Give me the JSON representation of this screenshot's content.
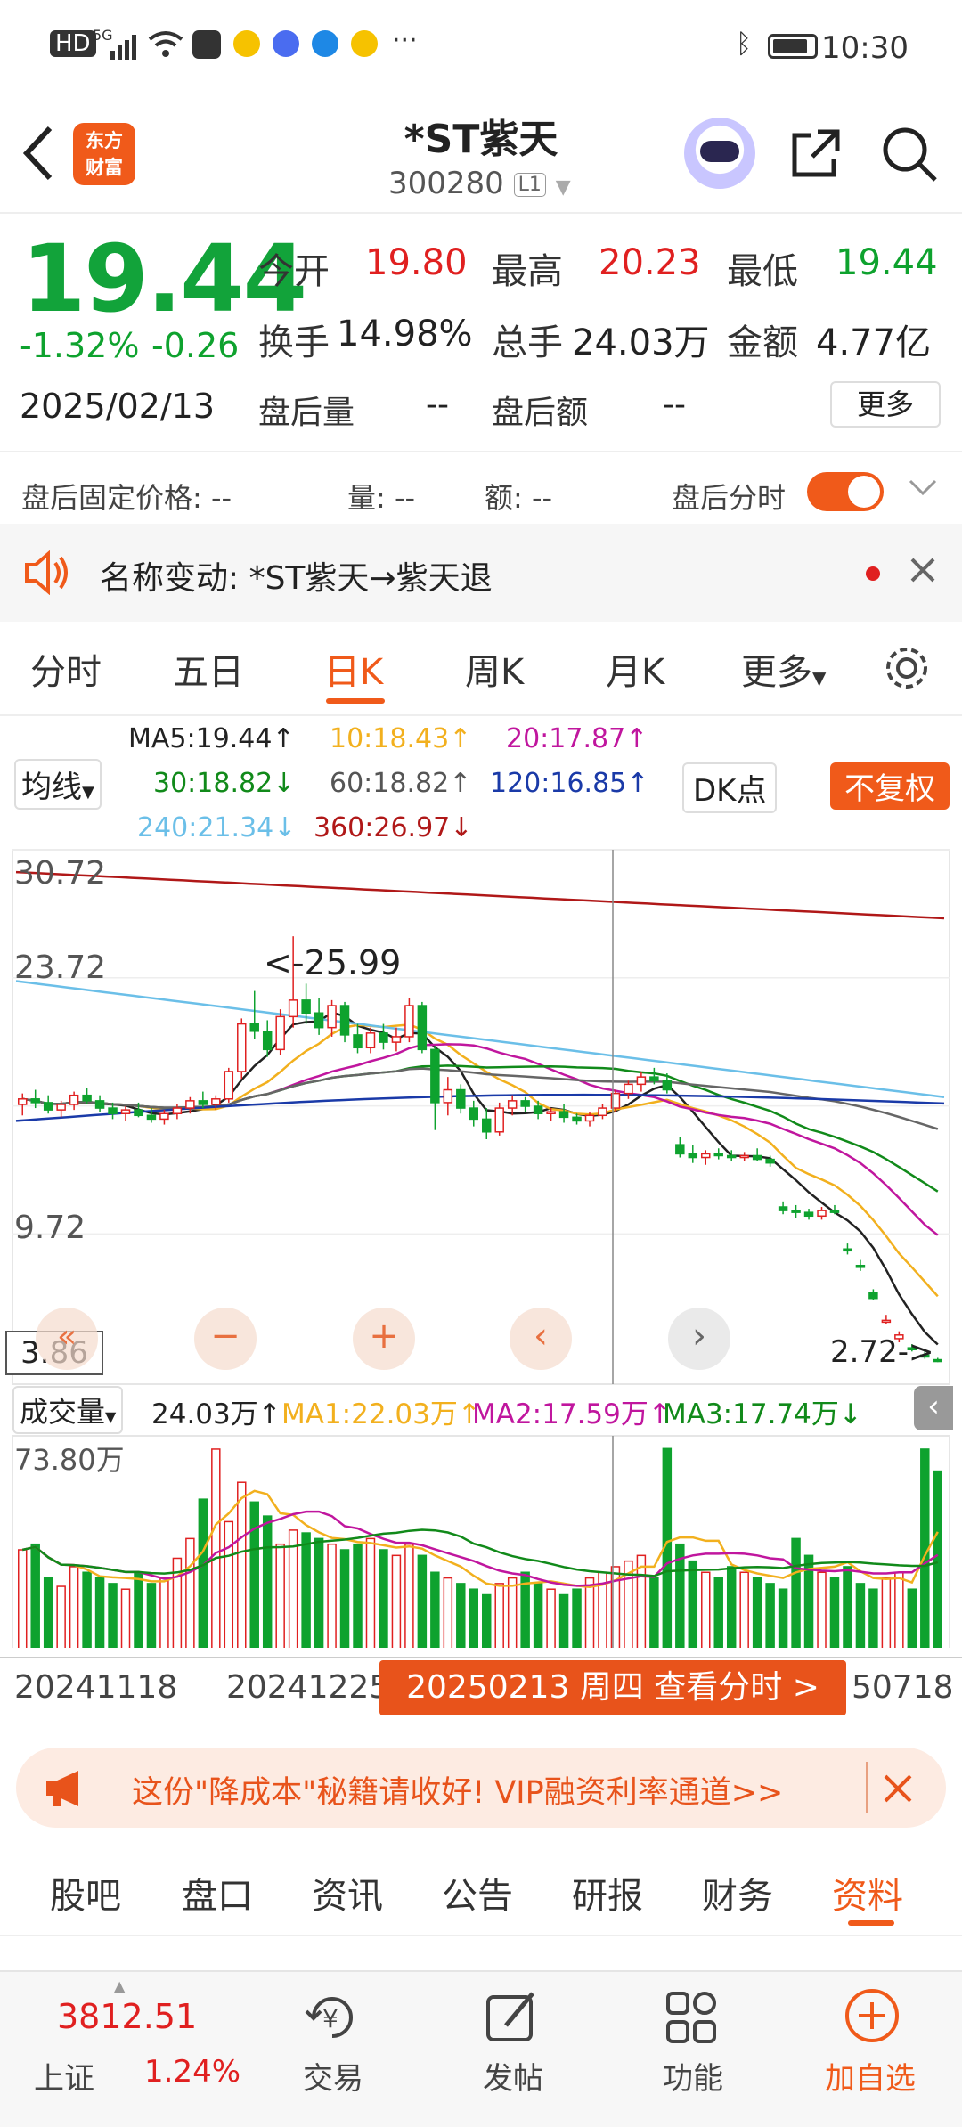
{
  "status_bar": {
    "time": "10:30",
    "network": "5G"
  },
  "header": {
    "title": "*ST紫天",
    "code": "300280",
    "level": "L1",
    "logo_line1": "东方",
    "logo_line2": "财富"
  },
  "quote": {
    "price": "19.44",
    "change_pct": "-1.32%",
    "change": "-0.26",
    "date": "2025/02/13",
    "open_label": "今开",
    "open": "19.80",
    "high_label": "最高",
    "high": "20.23",
    "low_label": "最低",
    "low": "19.44",
    "turnover_label": "换手",
    "turnover": "14.98%",
    "volume_label": "总手",
    "volume": "24.03万",
    "amount_label": "金额",
    "amount": "4.77亿",
    "after_vol_label": "盘后量",
    "after_vol": "--",
    "after_amt_label": "盘后额",
    "after_amt": "--",
    "more": "更多"
  },
  "after_hours": {
    "price_label": "盘后固定价格: --",
    "vol_label": "量: --",
    "amt_label": "额: --",
    "toggle_label": "盘后分时"
  },
  "notice": {
    "text": "名称变动: *ST紫天→紫天退"
  },
  "tabs": [
    "分时",
    "五日",
    "日K",
    "周K",
    "月K",
    "更多"
  ],
  "ma_legend": {
    "selector": "均线",
    "ma5": "MA5:19.44↑",
    "ma10": "10:18.43↑",
    "ma20": "20:17.87↑",
    "ma30": "30:18.82↓",
    "ma60": "60:18.82↑",
    "ma120": "120:16.85↑",
    "ma240": "240:21.34↓",
    "ma360": "360:26.97↓",
    "dk": "DK点",
    "adjust": "不复权"
  },
  "chart_data": {
    "type": "candlestick",
    "y_ticks": [
      "30.72",
      "23.72",
      "9.72",
      "3.86"
    ],
    "annotation_high": "<-25.99",
    "annotation_low": "2.72->",
    "x_labels": [
      "20241118",
      "20241225",
      "50718"
    ],
    "crosshair_label": "20250213 周四 查看分时 >",
    "volume": {
      "selector": "成交量",
      "current": "24.03万↑",
      "ma1": "MA1:22.03万↑",
      "ma2": "MA2:17.59万↑",
      "ma3": "MA3:17.74万↓",
      "y_tick": "73.80万"
    },
    "candles": [
      [
        16.8,
        17.4,
        16.2,
        17.1
      ],
      [
        17.1,
        17.6,
        16.6,
        16.9
      ],
      [
        16.9,
        17.3,
        16.3,
        16.5
      ],
      [
        16.5,
        17.0,
        16.1,
        16.8
      ],
      [
        16.8,
        17.5,
        16.5,
        17.3
      ],
      [
        17.3,
        17.7,
        16.8,
        17.0
      ],
      [
        17.0,
        17.3,
        16.4,
        16.6
      ],
      [
        16.6,
        16.9,
        16.0,
        16.3
      ],
      [
        16.3,
        16.7,
        15.9,
        16.5
      ],
      [
        16.5,
        16.9,
        16.1,
        16.2
      ],
      [
        16.2,
        16.6,
        15.8,
        16.0
      ],
      [
        16.0,
        16.5,
        15.7,
        16.3
      ],
      [
        16.3,
        16.8,
        16.0,
        16.6
      ],
      [
        16.6,
        17.2,
        16.3,
        17.0
      ],
      [
        17.0,
        17.5,
        16.6,
        16.8
      ],
      [
        16.8,
        17.3,
        16.5,
        17.1
      ],
      [
        17.1,
        18.8,
        16.9,
        18.6
      ],
      [
        18.6,
        21.5,
        18.2,
        21.2
      ],
      [
        21.2,
        23.0,
        20.4,
        20.8
      ],
      [
        20.8,
        21.4,
        19.4,
        19.8
      ],
      [
        19.8,
        22.0,
        19.5,
        21.6
      ],
      [
        21.6,
        25.99,
        21.0,
        22.5
      ],
      [
        22.5,
        23.4,
        21.2,
        21.8
      ],
      [
        21.8,
        22.6,
        20.6,
        21.0
      ],
      [
        21.0,
        22.5,
        20.5,
        22.2
      ],
      [
        22.2,
        22.4,
        20.2,
        20.6
      ],
      [
        20.6,
        21.2,
        19.6,
        19.9
      ],
      [
        19.9,
        21.0,
        19.6,
        20.7
      ],
      [
        20.7,
        21.2,
        19.8,
        20.2
      ],
      [
        20.2,
        21.0,
        19.7,
        20.5
      ],
      [
        20.5,
        22.6,
        20.2,
        22.2
      ],
      [
        22.2,
        22.4,
        19.6,
        19.8
      ],
      [
        19.8,
        20.0,
        15.4,
        16.9
      ],
      [
        16.9,
        18.3,
        16.2,
        17.6
      ],
      [
        17.6,
        17.9,
        16.3,
        16.6
      ],
      [
        16.6,
        17.0,
        15.6,
        16.0
      ],
      [
        16.0,
        16.6,
        14.9,
        15.3
      ],
      [
        15.3,
        16.9,
        15.1,
        16.6
      ],
      [
        16.6,
        17.3,
        16.2,
        17.0
      ],
      [
        17.0,
        17.2,
        16.4,
        16.7
      ],
      [
        16.7,
        17.0,
        16.0,
        16.3
      ],
      [
        16.3,
        16.6,
        15.9,
        16.4
      ],
      [
        16.4,
        16.8,
        15.8,
        16.1
      ],
      [
        16.1,
        16.3,
        15.7,
        15.9
      ],
      [
        15.9,
        16.4,
        15.6,
        16.2
      ],
      [
        16.2,
        16.8,
        16.0,
        16.6
      ],
      [
        16.6,
        17.6,
        16.4,
        17.4
      ],
      [
        17.4,
        18.1,
        17.1,
        17.9
      ],
      [
        17.9,
        18.6,
        17.5,
        18.3
      ],
      [
        18.3,
        18.8,
        17.9,
        18.1
      ],
      [
        18.1,
        18.5,
        17.4,
        17.6
      ],
      [
        14.6,
        15.0,
        13.9,
        14.1
      ],
      [
        14.1,
        14.6,
        13.6,
        13.9
      ],
      [
        13.9,
        14.3,
        13.5,
        14.1
      ],
      [
        14.1,
        14.4,
        13.8,
        14.0
      ],
      [
        14.0,
        14.3,
        13.7,
        13.9
      ],
      [
        13.9,
        14.2,
        13.7,
        14.0
      ],
      [
        14.0,
        14.4,
        13.7,
        13.8
      ],
      [
        13.8,
        14.0,
        13.4,
        13.6
      ],
      [
        11.2,
        11.5,
        10.8,
        11.0
      ],
      [
        11.0,
        11.3,
        10.6,
        10.9
      ],
      [
        10.9,
        11.1,
        10.5,
        10.7
      ],
      [
        10.7,
        11.2,
        10.5,
        11.0
      ],
      [
        11.0,
        11.3,
        10.8,
        10.9
      ],
      [
        8.9,
        9.2,
        8.6,
        8.8
      ],
      [
        8.0,
        8.3,
        7.7,
        7.9
      ],
      [
        6.5,
        6.7,
        6.1,
        6.2
      ],
      [
        5.0,
        5.3,
        4.8,
        5.0
      ],
      [
        4.0,
        4.4,
        3.8,
        4.2
      ],
      [
        3.5,
        3.7,
        3.3,
        3.4
      ],
      [
        3.1,
        3.3,
        2.9,
        3.0
      ],
      [
        2.85,
        2.95,
        2.72,
        2.8
      ]
    ],
    "volumes": [
      38,
      40,
      28,
      25,
      32,
      30,
      28,
      26,
      24,
      30,
      26,
      28,
      35,
      42,
      56,
      73.8,
      48,
      62,
      55,
      50,
      40,
      45,
      44,
      42,
      40,
      38,
      40,
      42,
      38,
      36,
      40,
      36,
      30,
      28,
      26,
      24,
      22,
      26,
      28,
      30,
      26,
      24,
      22,
      24,
      28,
      30,
      32,
      34,
      36,
      28,
      74,
      40,
      34,
      30,
      28,
      32,
      30,
      28,
      26,
      24,
      42,
      36,
      30,
      28,
      32,
      26,
      24,
      28,
      30,
      24,
      73.8,
      66
    ]
  },
  "promo": {
    "text": "这份\"降成本\"秘籍请收好! VIP融资利率通道>>"
  },
  "bottom_tabs": [
    "股吧",
    "盘口",
    "资讯",
    "公告",
    "研报",
    "财务",
    "资料"
  ],
  "nav": {
    "index_value": "3812.51",
    "index_name": "上证",
    "index_change": "1.24%",
    "trade": "交易",
    "post": "发帖",
    "func": "功能",
    "add": "加自选"
  },
  "colors": {
    "up": "#e02020",
    "down": "#0ea22e",
    "accent": "#f05a1a"
  }
}
